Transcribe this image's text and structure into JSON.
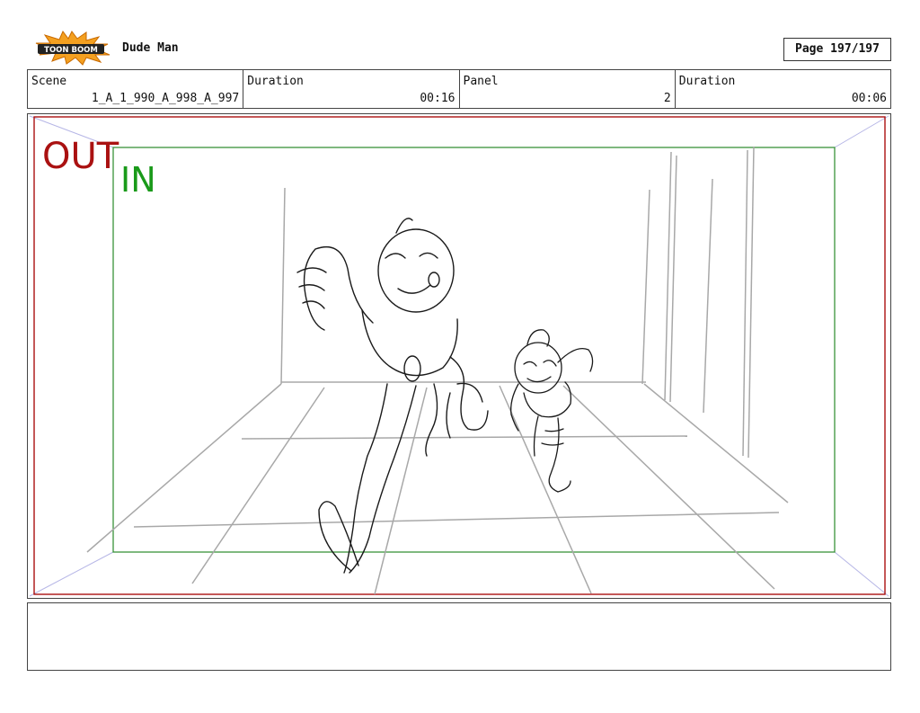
{
  "header": {
    "logo_text": "TOON BOOM",
    "project_title": "Dude Man",
    "page_label": "Page 197/197"
  },
  "info": {
    "scene_label": "Scene",
    "scene_value": "1_A_1_990_A_998_A_997",
    "scene_duration_label": "Duration",
    "scene_duration_value": "00:16",
    "panel_label": "Panel",
    "panel_value": "2",
    "panel_duration_label": "Duration",
    "panel_duration_value": "00:06"
  },
  "panel": {
    "out_label": "OUT",
    "in_label": "IN",
    "out_color": "#aa1111",
    "in_color": "#1a9a1a"
  },
  "notes": {
    "text": ""
  }
}
